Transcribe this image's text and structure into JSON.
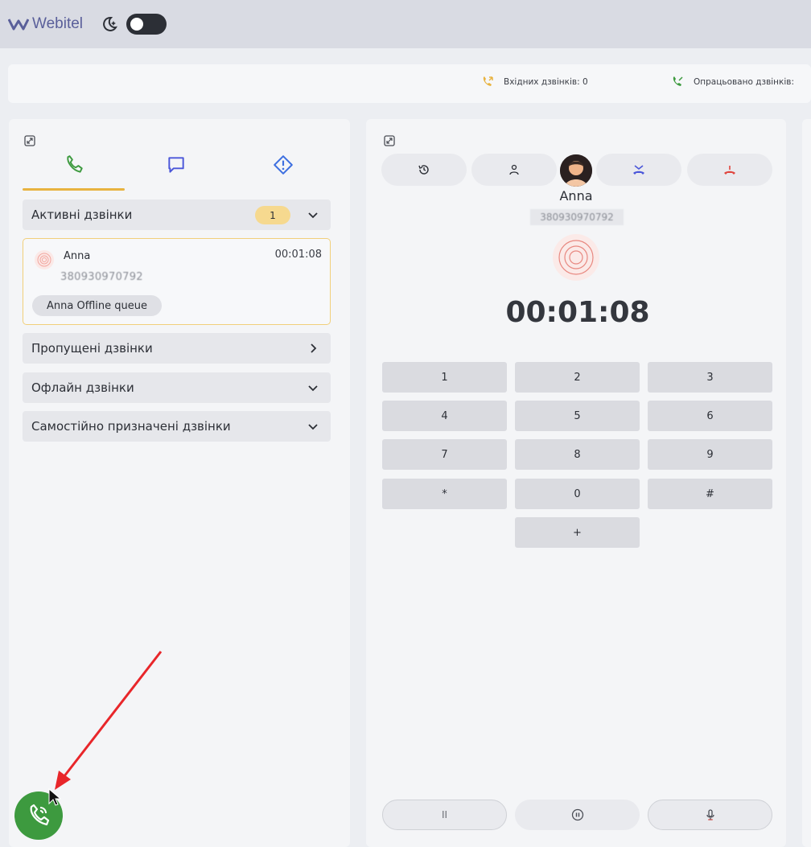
{
  "app": {
    "logo_text": "Webitel"
  },
  "stats": {
    "incoming_label": "Вхідних дзвінків: 0",
    "processed_label": "Опрацьовано дзвінків:"
  },
  "left_panel": {
    "sections": {
      "active": {
        "label": "Активні дзвінки",
        "count": "1"
      },
      "missed": {
        "label": "Пропущені дзвінки"
      },
      "offline": {
        "label": "Офлайн дзвінки"
      },
      "assigned": {
        "label": "Самостійно призначені дзвінки"
      }
    },
    "active_call": {
      "name": "Anna",
      "number": "380930970792",
      "duration": "00:01:08",
      "queue": "Anna Offline queue"
    }
  },
  "call_panel": {
    "contact_name": "Anna",
    "contact_number": "380930970792",
    "timer": "00:01:08",
    "keypad": [
      "1",
      "2",
      "3",
      "4",
      "5",
      "6",
      "7",
      "8",
      "9",
      "*",
      "0",
      "#",
      "+"
    ],
    "bottom_controls": {
      "hold_label": "II"
    }
  },
  "colors": {
    "accent_yellow": "#e8b340",
    "call_green": "#3d9a3f",
    "hangup_red": "#e0463f",
    "transfer_blue": "#4a56d9",
    "tab_phone_green": "#3d9a3f",
    "tab_chat_blue": "#4a56d9",
    "tab_alert_blue": "#3d6fe0"
  }
}
